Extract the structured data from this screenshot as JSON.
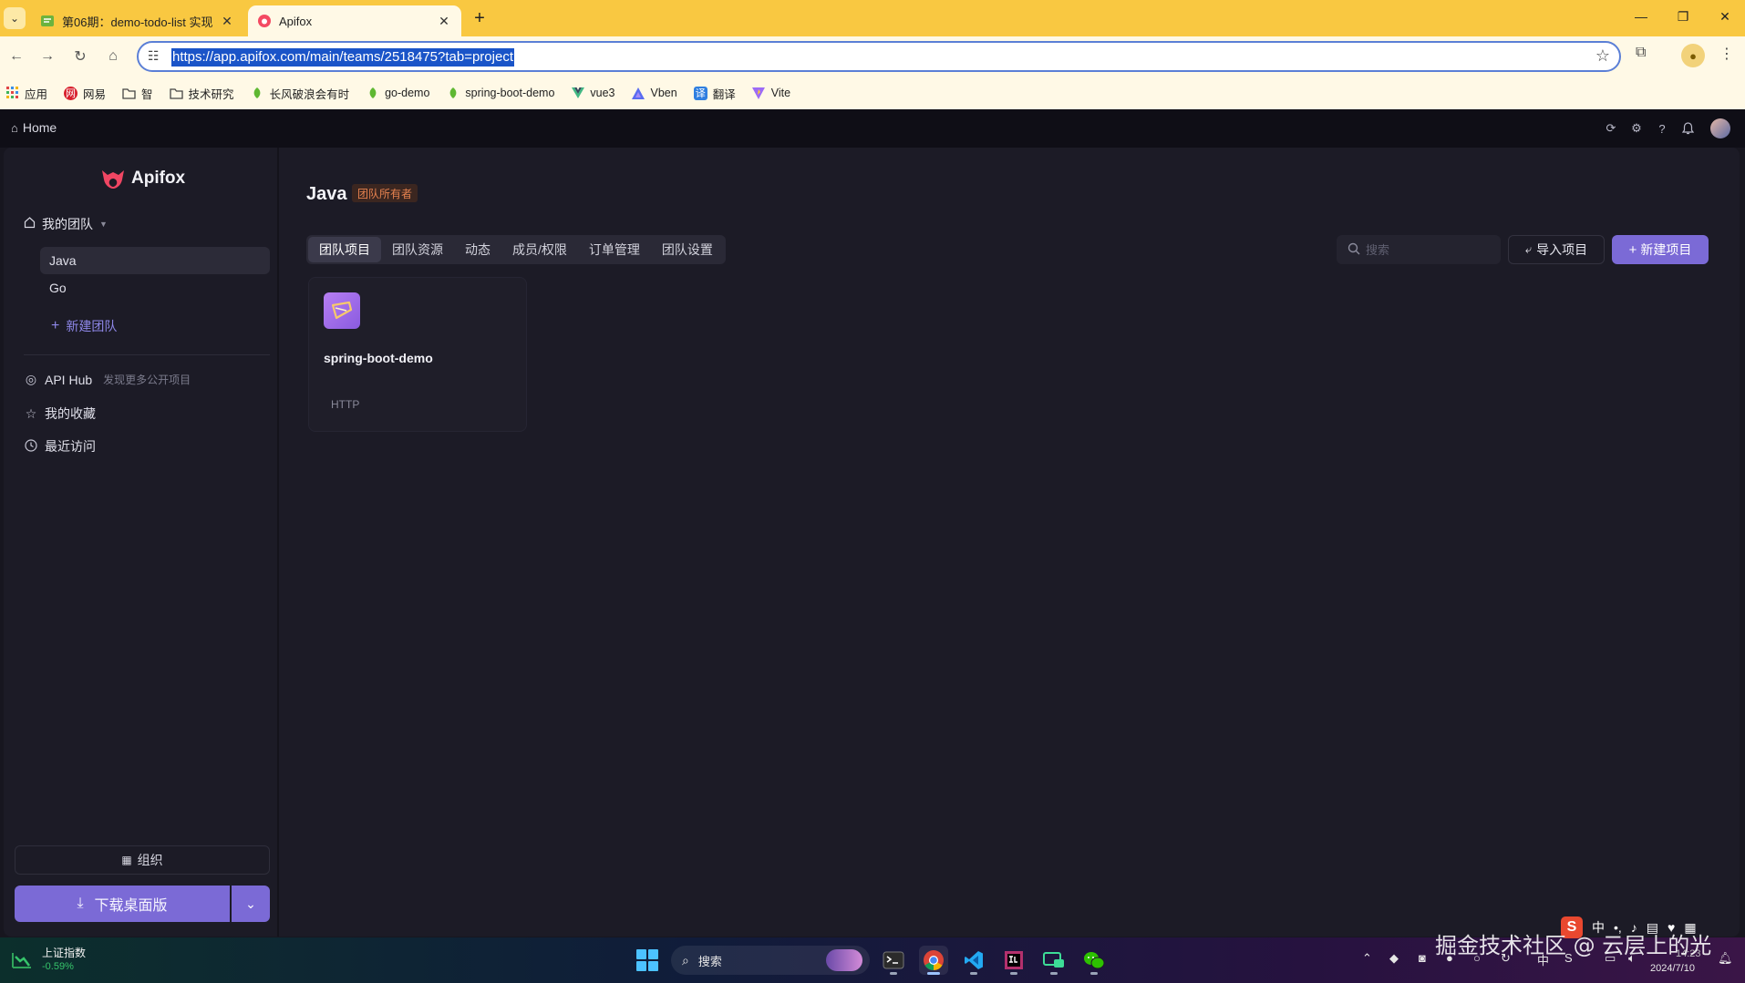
{
  "browser": {
    "tabs": [
      {
        "title": "第06期：demo-todo-list 实现",
        "icon": "task-note-icon",
        "active": false
      },
      {
        "title": "Apifox",
        "icon": "apifox-icon",
        "active": true
      }
    ],
    "new_tab": "+",
    "url": "https://app.apifox.com/main/teams/2518475?tab=project",
    "bookmarks": [
      {
        "label": "应用",
        "icon": "apps-grid-icon",
        "color": "#e04545"
      },
      {
        "label": "网易",
        "icon": "netease-icon",
        "color": "#d8202c"
      },
      {
        "label": "智",
        "icon": "folder-icon",
        "color": "#555555"
      },
      {
        "label": "技术研究",
        "icon": "folder-icon",
        "color": "#555555"
      },
      {
        "label": "长风破浪会有时",
        "icon": "leaf-icon",
        "color": "#5fb832"
      },
      {
        "label": "go-demo",
        "icon": "leaf-icon",
        "color": "#5fb832"
      },
      {
        "label": "spring-boot-demo",
        "icon": "leaf-icon",
        "color": "#5fb832"
      },
      {
        "label": "vue3",
        "icon": "vue-icon",
        "color": "#2f9e6a"
      },
      {
        "label": "Vben",
        "icon": "vben-icon",
        "color": "#5a6cf0"
      },
      {
        "label": "翻译",
        "icon": "translate-icon",
        "color": "#2f7fe0"
      },
      {
        "label": "Vite",
        "icon": "vite-icon",
        "color": "#9d6bf6"
      }
    ]
  },
  "app": {
    "home": "Home",
    "brand": "Apifox",
    "accent": "#7b6ad6",
    "sidebar": {
      "team_menu": "我的团队",
      "teams": [
        {
          "label": "Java",
          "active": true
        },
        {
          "label": "Go",
          "active": false
        }
      ],
      "new_team": "新建团队",
      "links": [
        {
          "label": "API Hub",
          "sub": "发现更多公开项目",
          "icon": "api-hub-icon"
        },
        {
          "label": "我的收藏",
          "sub": "",
          "icon": "star-icon"
        },
        {
          "label": "最近访问",
          "sub": "",
          "icon": "clock-icon"
        }
      ],
      "org_button": "组织",
      "download_button": "下载桌面版"
    },
    "main": {
      "team_title": "Java",
      "owner_badge": "团队所有者",
      "tabs": [
        {
          "label": "团队项目",
          "active": true
        },
        {
          "label": "团队资源",
          "active": false
        },
        {
          "label": "动态",
          "active": false
        },
        {
          "label": "成员/权限",
          "active": false
        },
        {
          "label": "订单管理",
          "active": false
        },
        {
          "label": "团队设置",
          "active": false
        }
      ],
      "search_placeholder": "搜索",
      "import_button": "导入项目",
      "new_button": "新建项目",
      "projects": [
        {
          "name": "spring-boot-demo",
          "type": "HTTP"
        }
      ]
    }
  },
  "taskbar": {
    "stock_name": "上证指数",
    "stock_change": "-0.59%",
    "search": "搜索",
    "date": "2024/7/10",
    "time": "14:23",
    "watermark": "掘金技术社区 @ 云层上的光",
    "ime_lang": "中"
  }
}
